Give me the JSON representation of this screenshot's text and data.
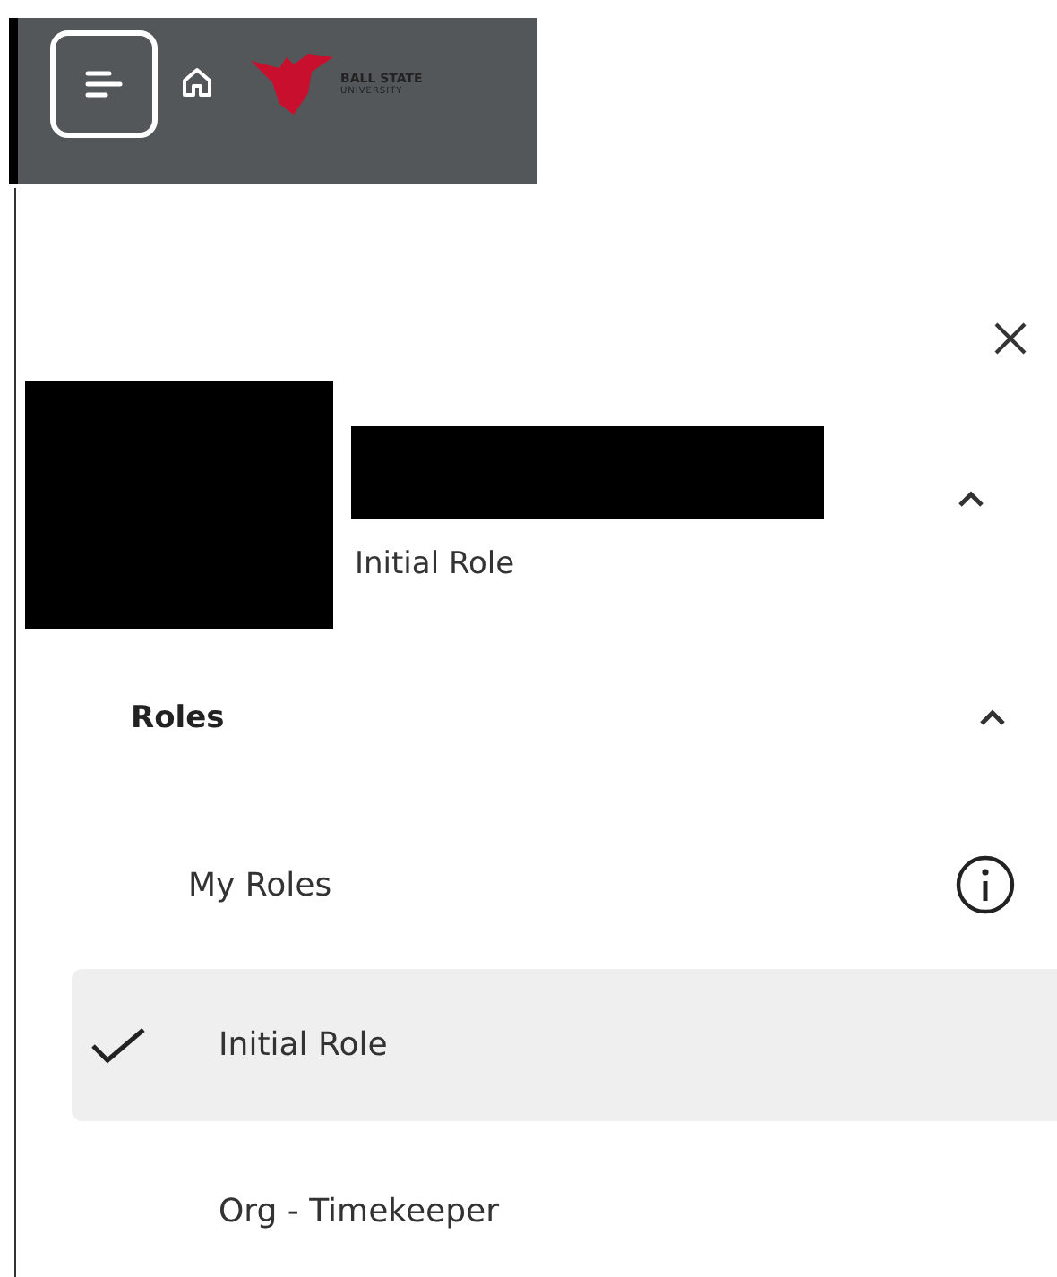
{
  "top_bar": {
    "logo": {
      "line1": "BALL STATE",
      "line2": "UNIVERSITY"
    }
  },
  "profile": {
    "role": "Initial Role",
    "expanded": true
  },
  "roles_section": {
    "label": "Roles",
    "expanded": true
  },
  "roles": [
    {
      "label": "My Roles",
      "kind": "header"
    },
    {
      "label": "Initial Role",
      "kind": "role",
      "selected": true
    },
    {
      "label": "Org - Timekeeper",
      "kind": "role",
      "selected": false
    }
  ]
}
